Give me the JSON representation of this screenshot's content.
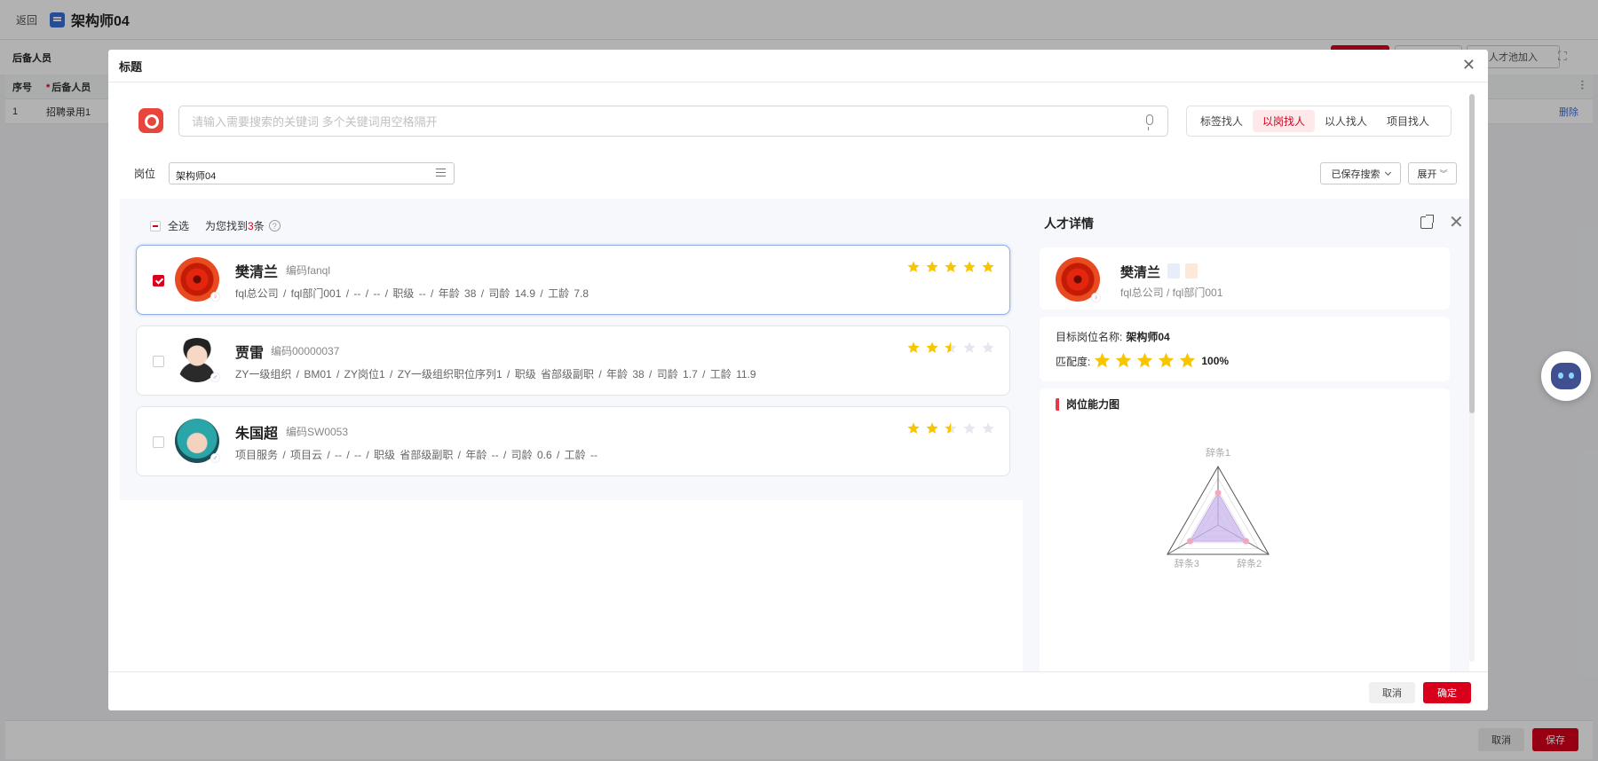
{
  "background": {
    "back_label": "返回",
    "page_title": "架构师04",
    "tab_label": "后备人员",
    "talent_join_label": "人才池加入",
    "table_headers": [
      "序号",
      "后备人员"
    ],
    "table_rows": [
      {
        "index": "1",
        "name": "招聘录用1",
        "action": "删除"
      }
    ],
    "footer_cancel": "取消",
    "footer_save": "保存"
  },
  "modal": {
    "title": "标题",
    "search_placeholder": "请输入需要搜索的关键词 多个关键词用空格隔开",
    "modes": [
      {
        "label": "标签找人",
        "active": false
      },
      {
        "label": "以岗找人",
        "active": true
      },
      {
        "label": "以人找人",
        "active": false
      },
      {
        "label": "项目找人",
        "active": false
      }
    ],
    "filter_label": "岗位",
    "filter_value": "架构师04",
    "saved_search_label": "已保存搜索",
    "expand_label": "展开",
    "select_all_label": "全选",
    "found_prefix": "为您找到",
    "found_count": "3",
    "found_suffix": "条",
    "help_icon": "?",
    "cancel_label": "取消",
    "confirm_label": "确定"
  },
  "candidates": [
    {
      "name": "樊清兰",
      "code": "编码fanql",
      "info": "fql总公司 / fql部门001 / -- / -- / 职级 -- / 年龄 38 / 司龄 14.9 / 工龄 7.8",
      "rating": 5,
      "selected": true,
      "gender": "female",
      "gender_symbol": "♀",
      "avatar": "flower-avatar"
    },
    {
      "name": "贾雷",
      "code": "编码00000037",
      "info": "ZY一级组织 / BM01 / ZY岗位1 / ZY一级组织职位序列1 / 职级 省部级副职 / 年龄 38 / 司龄 1.7 / 工龄 11.9",
      "rating": 2.5,
      "selected": false,
      "gender": "male",
      "gender_symbol": "♂",
      "avatar": "man-avatar"
    },
    {
      "name": "朱国超",
      "code": "编码SW0053",
      "info": "项目服务 / 项目云 / -- / -- / 职级 省部级副职 / 年龄 -- / 司龄 0.6 / 工龄 --",
      "rating": 2.5,
      "selected": false,
      "gender": "male",
      "gender_symbol": "♂",
      "avatar": "girl-avatar"
    }
  ],
  "detail": {
    "title": "人才详情",
    "name": "樊清兰",
    "org": "fql总公司 / fql部门001",
    "target_label": "目标岗位名称:",
    "target_value": "架构师04",
    "match_label": "匹配度:",
    "match_rating": 5,
    "match_percent": "100%",
    "radar_title": "岗位能力图",
    "radar": {
      "type": "radar",
      "axes": [
        "辞条1",
        "辞条2",
        "辞条3"
      ],
      "values": [
        0.55,
        0.55,
        0.55
      ],
      "max": 1
    },
    "tag_colors": [
      "#e6eef9",
      "#fde9d9"
    ]
  },
  "colors": {
    "accent": "#d9001b",
    "star": "#f7c600",
    "star_empty": "#e4e7ed",
    "radar_fill": "#c9b6ec"
  }
}
